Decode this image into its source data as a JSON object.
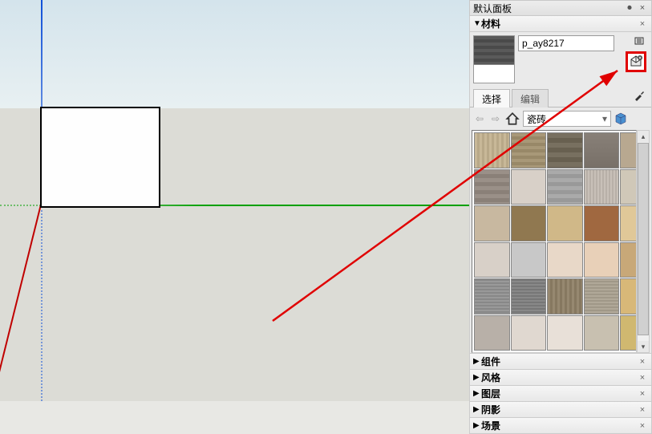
{
  "panel": {
    "header": "默认面板",
    "sections": {
      "materials": {
        "title": "材料",
        "open": true,
        "material_name": "p_ay8217",
        "tabs": {
          "select": "选择",
          "edit": "编辑"
        },
        "category": "瓷砖",
        "swatches": [
          {
            "bg": "repeating-linear-gradient(90deg,#c8b898 0 3px,#b8a888 3px 6px)"
          },
          {
            "bg": "repeating-linear-gradient(#a89878 0 4px,#988868 4px 8px)"
          },
          {
            "bg": "repeating-linear-gradient(#787060 0 6px,#686050 6px 12px)"
          },
          {
            "bg": "linear-gradient(#888078,#787068)"
          },
          {
            "bg": "#b8a890"
          },
          {
            "bg": "repeating-linear-gradient(#9a9088 0 5px,#8a8078 5px 10px)"
          },
          {
            "bg": "#d8d0c8"
          },
          {
            "bg": "repeating-linear-gradient(#aaa 0 5px,#999 5px 10px)"
          },
          {
            "bg": "repeating-linear-gradient(90deg,#c8c0b8 0 2px,#b8b0a8 2px 4px)"
          },
          {
            "bg": "#d0c8b8"
          },
          {
            "bg": "#c8b8a0"
          },
          {
            "bg": "#907850"
          },
          {
            "bg": "#d0b888"
          },
          {
            "bg": "#a06840"
          },
          {
            "bg": "#e0c898"
          },
          {
            "bg": "#d8d0c8"
          },
          {
            "bg": "#c8c8c8"
          },
          {
            "bg": "#e8d8c8"
          },
          {
            "bg": "#e8d0b8"
          },
          {
            "bg": "#c8a878"
          },
          {
            "bg": "repeating-linear-gradient(#888 0 2px,#999 2px 4px)"
          },
          {
            "bg": "repeating-linear-gradient(#777 0 2px,#888 2px 4px)"
          },
          {
            "bg": "repeating-linear-gradient(90deg,#968870 0 3px,#867860 3px 6px)"
          },
          {
            "bg": "repeating-linear-gradient(#b0a898 0 2px,#a09888 2px 4px)"
          },
          {
            "bg": "#d8b878"
          },
          {
            "bg": "#b8b0a8"
          },
          {
            "bg": "#e0d8d0"
          },
          {
            "bg": "#e8e0d8"
          },
          {
            "bg": "#c8c0b0"
          },
          {
            "bg": "#d0b870"
          }
        ]
      },
      "collapsed": [
        {
          "title": "组件"
        },
        {
          "title": "风格"
        },
        {
          "title": "图层"
        },
        {
          "title": "阴影"
        },
        {
          "title": "场景"
        }
      ]
    }
  },
  "icons": {
    "pin": "⏺",
    "close": "×",
    "back": "⇦",
    "fwd": "⇨",
    "home": "⌂",
    "chev": "▾",
    "tri_right": "▶",
    "tri_down": "▼",
    "scroll_up": "▴",
    "scroll_down": "▾"
  }
}
